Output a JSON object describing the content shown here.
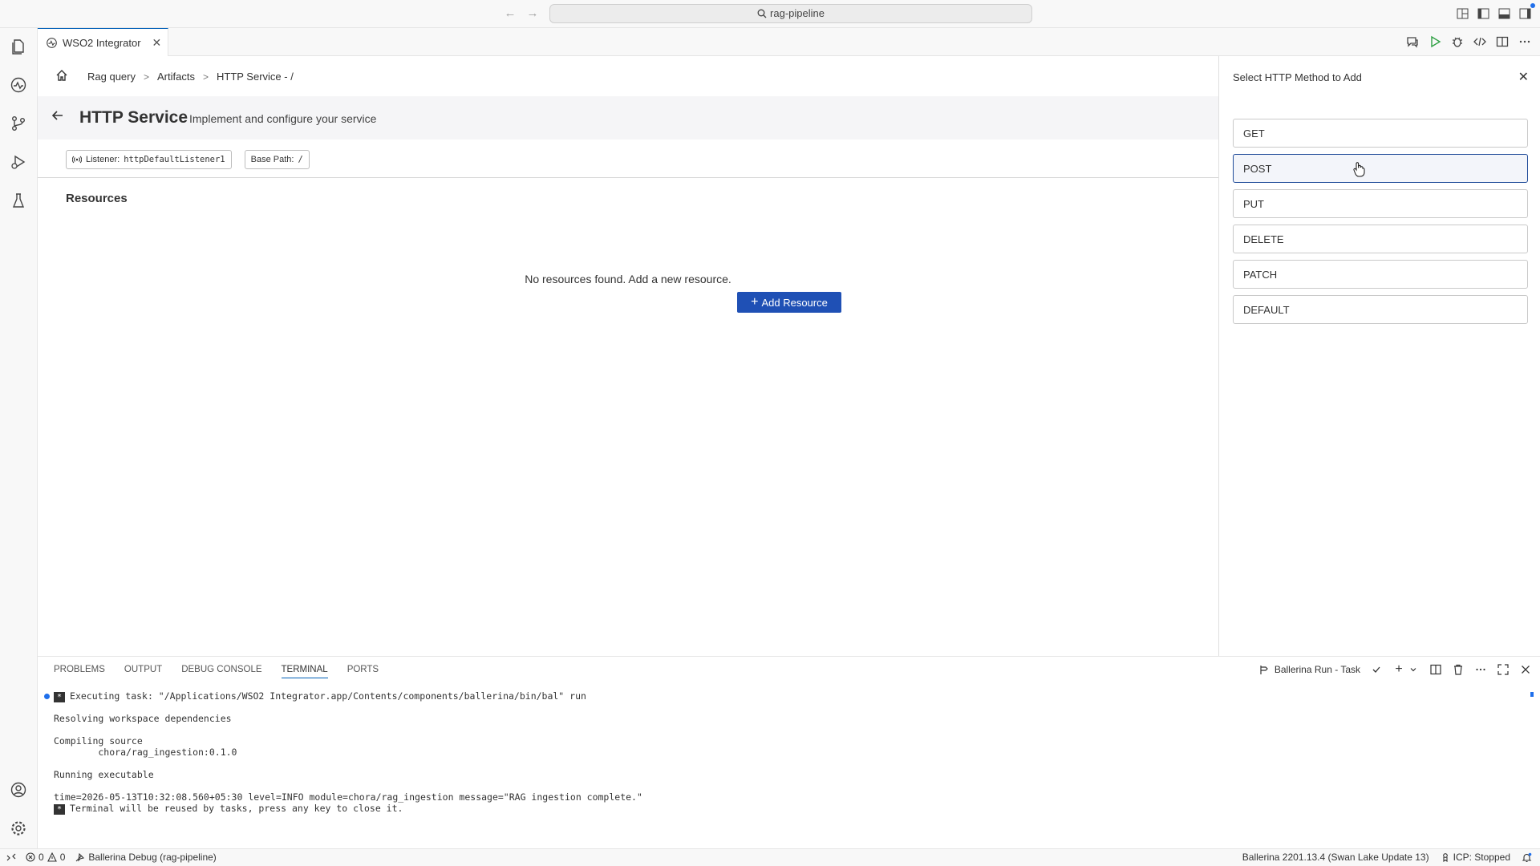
{
  "window": {
    "search_text": "rag-pipeline"
  },
  "tab": {
    "label": "WSO2 Integrator"
  },
  "breadcrumb": {
    "home": "home",
    "items": [
      "Rag query",
      "Artifacts",
      "HTTP Service - /"
    ]
  },
  "service": {
    "title": "HTTP Service",
    "subtitle": "Implement and configure your service",
    "listener_label": "Listener:",
    "listener_value": "httpDefaultListener1",
    "basepath_label": "Base Path:",
    "basepath_value": "/",
    "resources_heading": "Resources",
    "empty_message": "No resources found. Add a new resource.",
    "add_button": "Add Resource"
  },
  "side_panel": {
    "title": "Select HTTP Method to Add",
    "methods": [
      "GET",
      "POST",
      "PUT",
      "DELETE",
      "PATCH",
      "DEFAULT"
    ],
    "hovered": "POST"
  },
  "bottom_panel": {
    "tabs": [
      "PROBLEMS",
      "OUTPUT",
      "DEBUG CONSOLE",
      "TERMINAL",
      "PORTS"
    ],
    "active_tab": "TERMINAL",
    "task_label": "Ballerina Run - Task",
    "terminal": {
      "l1": "Executing task: \"/Applications/WSO2 Integrator.app/Contents/components/ballerina/bin/bal\" run",
      "l2": "Resolving workspace dependencies",
      "l3": "Compiling source",
      "l4": "        chora/rag_ingestion:0.1.0",
      "l5": "Running executable",
      "l6": "time=2026-05-13T10:32:08.560+05:30 level=INFO module=chora/rag_ingestion message=\"RAG ingestion complete.\"",
      "l7": "Terminal will be reused by tasks, press any key to close it."
    }
  },
  "status_bar": {
    "errors": "0",
    "warnings": "0",
    "debug": "Ballerina Debug (rag-pipeline)",
    "version": "Ballerina 2201.13.4 (Swan Lake Update 13)",
    "icp": "ICP: Stopped"
  },
  "colors": {
    "accent": "#1f50b5",
    "focus_border": "#005fb8"
  }
}
